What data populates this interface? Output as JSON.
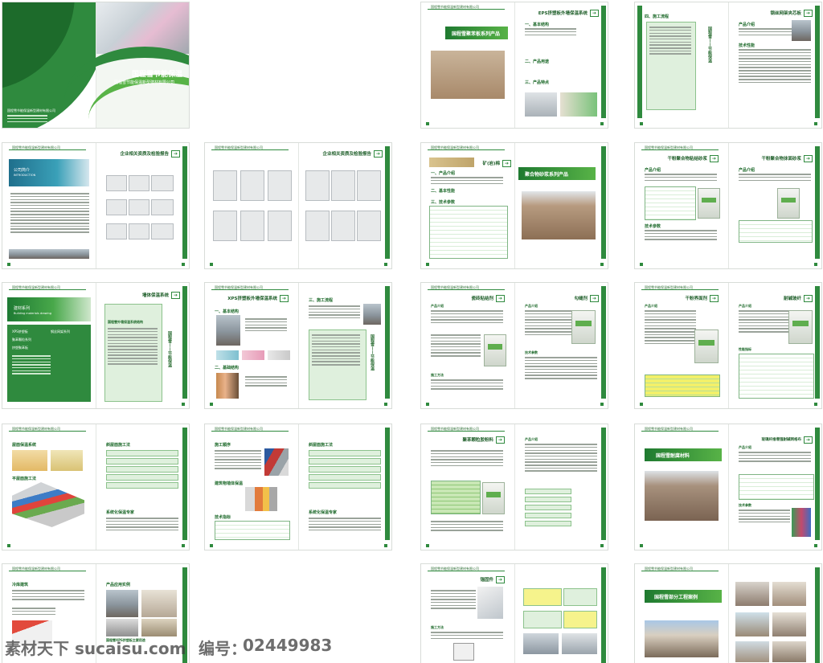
{
  "cover": {
    "title": "国程雪节能保温",
    "subtitle": "国程雪节能保温新型建材有限公司",
    "company_small": "国程雪节能保温新型建材有限公司"
  },
  "company_header": "国程雪节能保温新型建材有限公司",
  "spreads": [
    {
      "left_title": "",
      "right_title": "EPS挤塑板外墙保温系统",
      "band": "国程雪聚苯板系列产品",
      "sections": [
        "一、基本结构",
        "二、产品用途",
        "三、产品特点"
      ]
    },
    {
      "left_title": "四、施工流程",
      "right_title": "钢丝网架夹芯板",
      "sections": [
        "产品介绍",
        "技术性能"
      ],
      "vcap": "国程雪——节能保温"
    },
    {
      "left_title": "公司简介",
      "left_sub": "INTRODUCTION",
      "right_title": "企业相关资质及检验报告"
    },
    {
      "left_title": "",
      "right_title": "企业相关资质及检验报告"
    },
    {
      "left_title": "矿(岩)棉",
      "right_title": "",
      "band": "聚合物砂浆系列产品",
      "sections": [
        "一、产品介绍",
        "二、基本性能",
        "三、技术参数"
      ]
    },
    {
      "left_title": "干粉聚合物粘结砂浆",
      "right_title": "干粉聚合物抹面砂浆",
      "sections": [
        "产品介绍",
        "技术参数"
      ]
    },
    {
      "left_title": "建材系列",
      "left_sub": "Building materials drawing",
      "right_title": "墙体保温系统",
      "sections": [
        "XPS挤塑板",
        "聚苯颗粒系列",
        "挤塑聚苯板",
        "钢丝网架系列"
      ],
      "right_section": "国程雪外墙保温系统结构"
    },
    {
      "left_title": "XPS挤塑板外墙保温系统",
      "right_title": "",
      "sections": [
        "一、基本结构",
        "二、基础结构",
        "三、施工流程"
      ],
      "vcap": "国程雪——节能保温"
    },
    {
      "left_title": "瓷砖粘结剂",
      "right_title": "勾缝剂",
      "sections": [
        "产品介绍",
        "技术参数",
        "施工方法"
      ]
    },
    {
      "left_title": "干粉界面剂",
      "right_title": "耐碱玻纤",
      "sections": [
        "产品介绍",
        "施工方法",
        "性能指标"
      ]
    },
    {
      "left_title": "屋面保温系统",
      "right_title": "斜屋面施工法",
      "sections": [
        "平屋面施工法",
        "系统化保温专家"
      ]
    },
    {
      "left_title": "施工顺序",
      "right_title": "斜屋面施工法",
      "sections": [
        "建筑物墙体保温",
        "技术指标",
        "系统化保温专家"
      ]
    },
    {
      "left_title": "聚苯颗粒胶粉料",
      "right_title": "",
      "sections": [
        "产品介绍",
        "技术参数"
      ]
    },
    {
      "left_title": "",
      "right_title": "玻璃纤维增强耐碱网格布",
      "band": "国程雪耐腐材料",
      "sections": [
        "产品介绍",
        "技术参数"
      ]
    },
    {
      "left_title": "冷库建筑",
      "right_title": "产品应用实例",
      "sections": [
        "国程雪XPS挤塑板主要用途"
      ]
    },
    {
      "left_title": "锚固件",
      "right_title": "",
      "sections": [
        "产品介绍",
        "施工方法"
      ]
    },
    {
      "left_title": "",
      "right_title": "",
      "band": "国程雪部分工程案例"
    }
  ],
  "watermark": {
    "site": "素材天下 sucaisu.com",
    "code_label": "编号：",
    "code": "02449983"
  },
  "colors": {
    "brand_green": "#2f8a3e",
    "light_green": "#58b347",
    "pale_green": "#dff0dd"
  }
}
